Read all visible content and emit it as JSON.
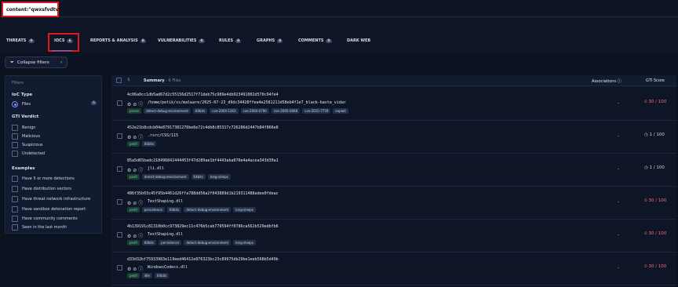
{
  "search": {
    "query": "content:\"qwxsfvdtv\""
  },
  "tabs": [
    {
      "label": "THREATS",
      "count": "0"
    },
    {
      "label": "IOCS",
      "count": "6"
    },
    {
      "label": "REPORTS & ANALYSIS",
      "count": "0"
    },
    {
      "label": "VULNERABILITIES",
      "count": "0"
    },
    {
      "label": "RULES",
      "count": "0"
    },
    {
      "label": "GRAPHS",
      "count": "0"
    },
    {
      "label": "COMMENTS",
      "count": "0"
    },
    {
      "label": "DARK WEB",
      "count": ""
    }
  ],
  "collapse_filters": {
    "label": "Collapse filters",
    "icon": "filter-icon",
    "chevron": "chevron-left-icon"
  },
  "filters": {
    "title": "Filters",
    "ioc_type": {
      "heading": "IoC Type",
      "options": [
        {
          "label": "Files",
          "count": "6"
        }
      ]
    },
    "gti_verdict": {
      "heading": "GTI Verdict",
      "options": [
        "Benign",
        "Malicious",
        "Suspicious",
        "Undetected"
      ]
    },
    "examples": {
      "heading": "Examples",
      "options": [
        "Have 5 or more detections",
        "Have distribution vectors",
        "Have threat network infrastructure",
        "Have sandbox detonation report",
        "Have community comments",
        "Seen in the last month"
      ]
    }
  },
  "results": {
    "header": {
      "summary": "Summary",
      "count": " - 6 Files",
      "associations": "Associations",
      "gti_score": "GTI Score"
    },
    "rows": [
      {
        "hash": "4c06a0cc1db5ad67d2c55156d2517f71deb75c989e4db923491002d570c94fe4",
        "filename": "/home/petik/ss/malware/2025-07-23_d9dc34428ffea4e2581211d58eb4f1e7_black-basta_vidar",
        "tags": [
          "peexe",
          "detect-debug-environment",
          "64bits",
          "cve-2004-1363",
          "cve-2004-0790",
          "cve-2005-0068",
          "cve-2015-7759",
          "exploit"
        ],
        "associations": "-",
        "score": "30 / 100",
        "verdict": "bad"
      },
      {
        "hash": "452e21b8cdcb04e87917381276be6e72c4db8c85317c726286d2447b84f066e8",
        "filename": ".rsrc/CSS/115",
        "tags": [
          "pedll",
          "64bits"
        ],
        "associations": "-",
        "score": "1 / 100",
        "verdict": "ok"
      },
      {
        "hash": "85a5d65badc218496842444453f47d289ae1bf4443aba070e4a4acea343d30a1",
        "filename": "jli.dll",
        "tags": [
          "pedll",
          "detect-debug-environment",
          "64bits",
          "long-sleeps"
        ],
        "associations": "-",
        "score": "1 / 100",
        "verdict": "ok"
      },
      {
        "hash": "486f35b03c45f95b4461d26ffa788dd56a2f043889d1b219311488adee0fdeac",
        "filename": "TextShaping.dll",
        "tags": [
          "pedll",
          "persistence",
          "64bits",
          "detect-debug-environment",
          "long-sleeps"
        ],
        "associations": "-",
        "score": "30 / 100",
        "verdict": "bad"
      },
      {
        "hash": "4b139191c81310b0cc973829ec11c476b5cab779594ff0786ca562b529edbfb6",
        "filename": "TextShaping.dll",
        "tags": [
          "pedll",
          "64bits",
          "persistence",
          "detect-debug-environment",
          "long-sleeps"
        ],
        "associations": "-",
        "score": "30 / 100",
        "verdict": "bad"
      },
      {
        "hash": "d33d32bf75933983e119eed46412e876323bc23c89975db29be1eeb568b5d49b",
        "filename": "WindowsCodecs.dll",
        "tags": [
          "pedll",
          "idle",
          "64bits"
        ],
        "associations": "-",
        "score": "30 / 100",
        "verdict": "bad"
      }
    ]
  },
  "colors": {
    "accent": "#3b82f6",
    "highlight": "#e0191b",
    "malicious": "#ff6b6b"
  }
}
